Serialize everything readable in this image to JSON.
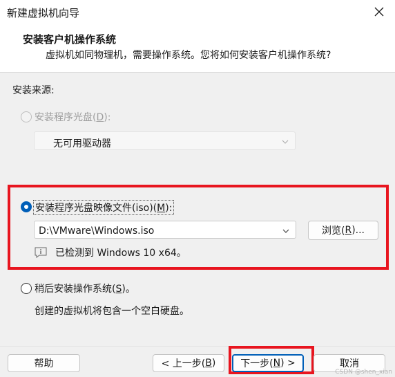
{
  "window": {
    "title": "新建虚拟机向导",
    "close_icon": "close-icon"
  },
  "header": {
    "title": "安装客户机操作系统",
    "subtitle": "虚拟机如同物理机，需要操作系统。您将如何安装客户机操作系统?"
  },
  "install_source": {
    "label": "安装来源:",
    "options": [
      {
        "label": "安装程序光盘(D):",
        "label_main": "安装程序光盘(",
        "label_key": "D",
        "label_tail": "):",
        "selected": false,
        "enabled": false
      },
      {
        "label": "安装程序光盘映像文件(iso)(M):",
        "label_main": "安装程序光盘映像文件(iso)(",
        "label_key": "M",
        "label_tail": "):",
        "selected": true,
        "enabled": true
      },
      {
        "label": "稍后安装操作系统(S)。",
        "label_main": "稍后安装操作系统(",
        "label_key": "S",
        "label_tail": ")。",
        "selected": false,
        "enabled": true
      }
    ],
    "drive_dropdown": {
      "value": "无可用驱动器",
      "enabled": false
    },
    "iso_dropdown": {
      "value": "D:\\VMware\\Windows.iso"
    },
    "browse_button": {
      "label_main": "浏览(",
      "label_key": "R",
      "label_tail": ")..."
    },
    "detected_text": "已检测到 Windows 10 x64。",
    "later_note": "创建的虚拟机将包含一个空白硬盘。"
  },
  "footer": {
    "help": "帮助",
    "back": {
      "label_main": "< 上一步(",
      "label_key": "B",
      "label_tail": ")"
    },
    "next": {
      "label_main": "下一步(",
      "label_key": "N",
      "label_tail": ") >"
    },
    "cancel": "取消"
  },
  "watermark": "CSDN @shen_xian",
  "colors": {
    "accent": "#005fb8",
    "highlight": "#e8151f"
  }
}
